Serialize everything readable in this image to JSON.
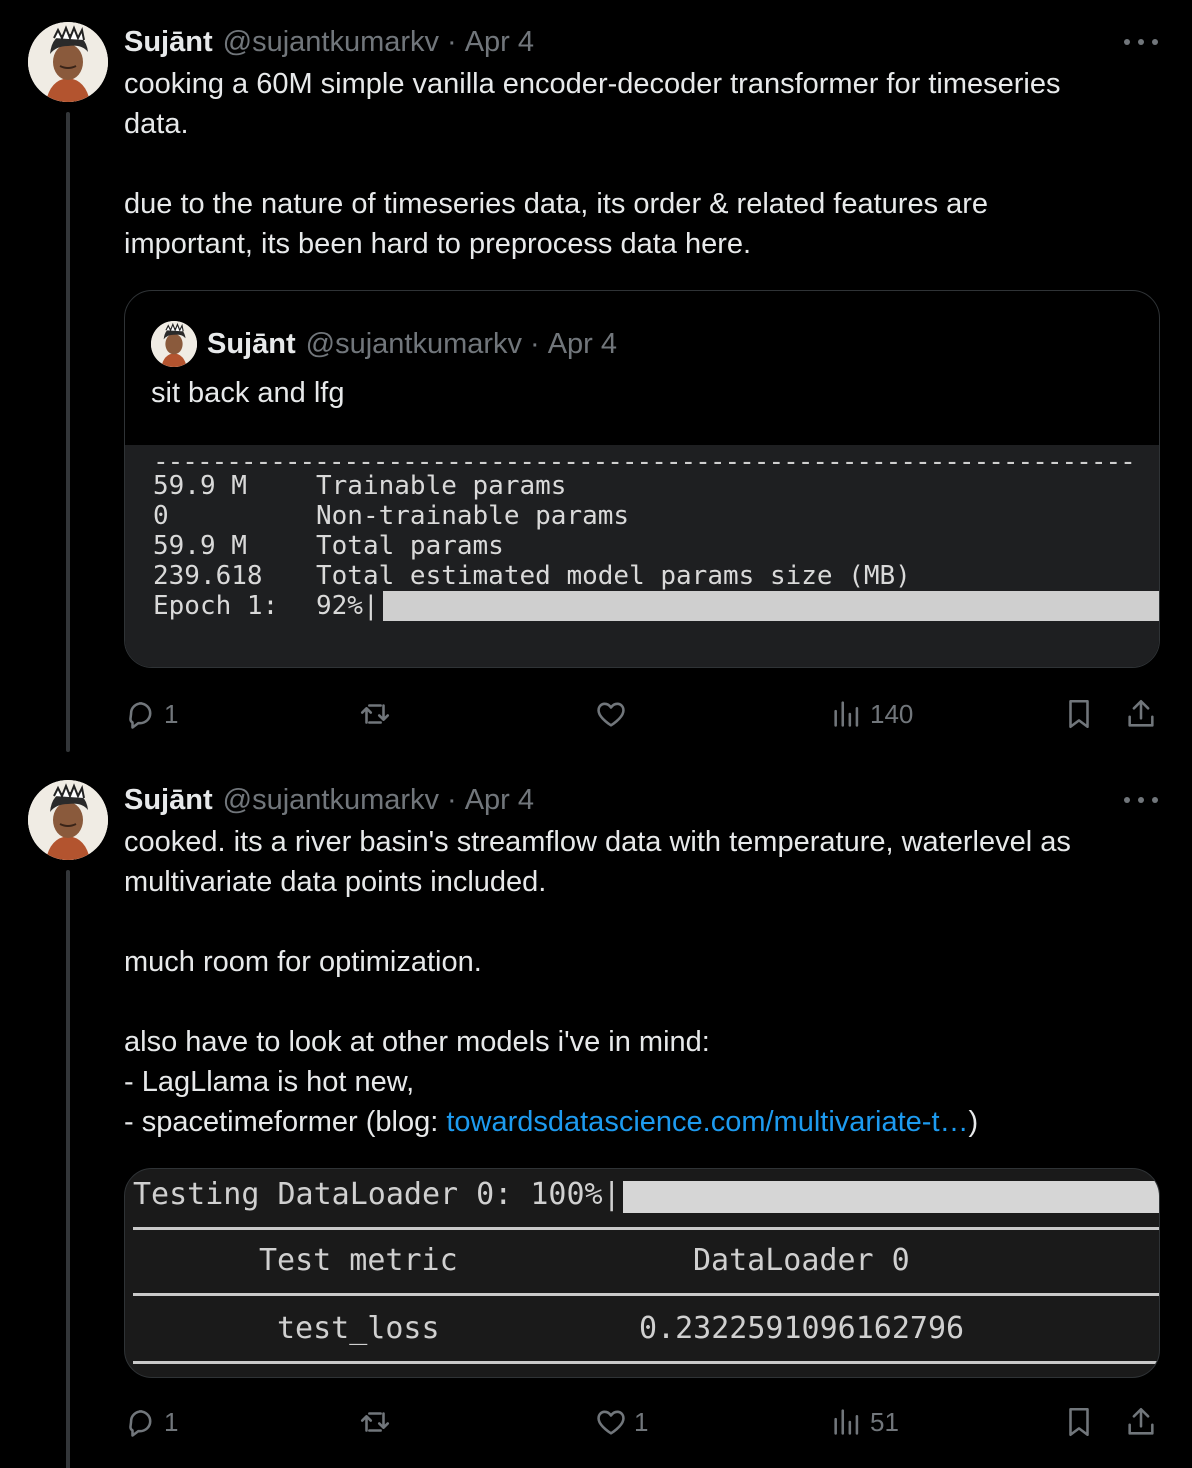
{
  "tweet1": {
    "author_name": "Sujānt",
    "handle": "@sujantkumarkv",
    "separator": "·",
    "date": "Apr 4",
    "text_lines": [
      "cooking a 60M simple vanilla encoder-decoder transformer for timeseries",
      "data.",
      "due to the nature of timeseries data, its order & related features are",
      "important, its been hard to preprocess data here."
    ],
    "quote": {
      "author_name": "Sujānt",
      "handle": "@sujantkumarkv",
      "separator": "·",
      "date": "Apr 4",
      "text": "sit back and lfg",
      "terminal": {
        "rows": [
          {
            "value": "59.9 M",
            "label": "Trainable params"
          },
          {
            "value": "0",
            "label": "Non-trainable params"
          },
          {
            "value": "59.9 M",
            "label": "Total params"
          },
          {
            "value": "239.618",
            "label": "Total estimated model params size (MB)"
          },
          {
            "value": "Epoch 1:",
            "label": "92%|"
          }
        ],
        "progress_percent": 92
      }
    },
    "actions": {
      "replies": "1",
      "views": "140"
    }
  },
  "tweet2": {
    "author_name": "Sujānt",
    "handle": "@sujantkumarkv",
    "separator": "·",
    "date": "Apr 4",
    "text_lines": [
      "cooked. its a river basin's streamflow data with temperature, waterlevel as",
      "multivariate data points included.",
      "much room for optimization.",
      "also have to look at other models i've in mind:",
      "- LagLlama is hot new,",
      "- spacetimeformer (blog: "
    ],
    "link_text": "towardsdatascience.com/multivariate-t…",
    "link_suffix": ")",
    "media": {
      "testing_line": "Testing DataLoader 0: 100%|",
      "progress_percent": 100,
      "header": [
        "Test metric",
        "DataLoader 0"
      ],
      "row": [
        "test_loss",
        "0.2322591096162796"
      ]
    },
    "actions": {
      "replies": "1",
      "likes": "1",
      "views": "51"
    }
  },
  "icons": [
    "more-icon",
    "reply-icon",
    "retweet-icon",
    "like-icon",
    "views-icon",
    "bookmark-icon",
    "share-icon"
  ],
  "colors": {
    "background": "#000000",
    "text": "#e7e9ea",
    "secondary": "#71767b",
    "link": "#1d9bf0"
  }
}
